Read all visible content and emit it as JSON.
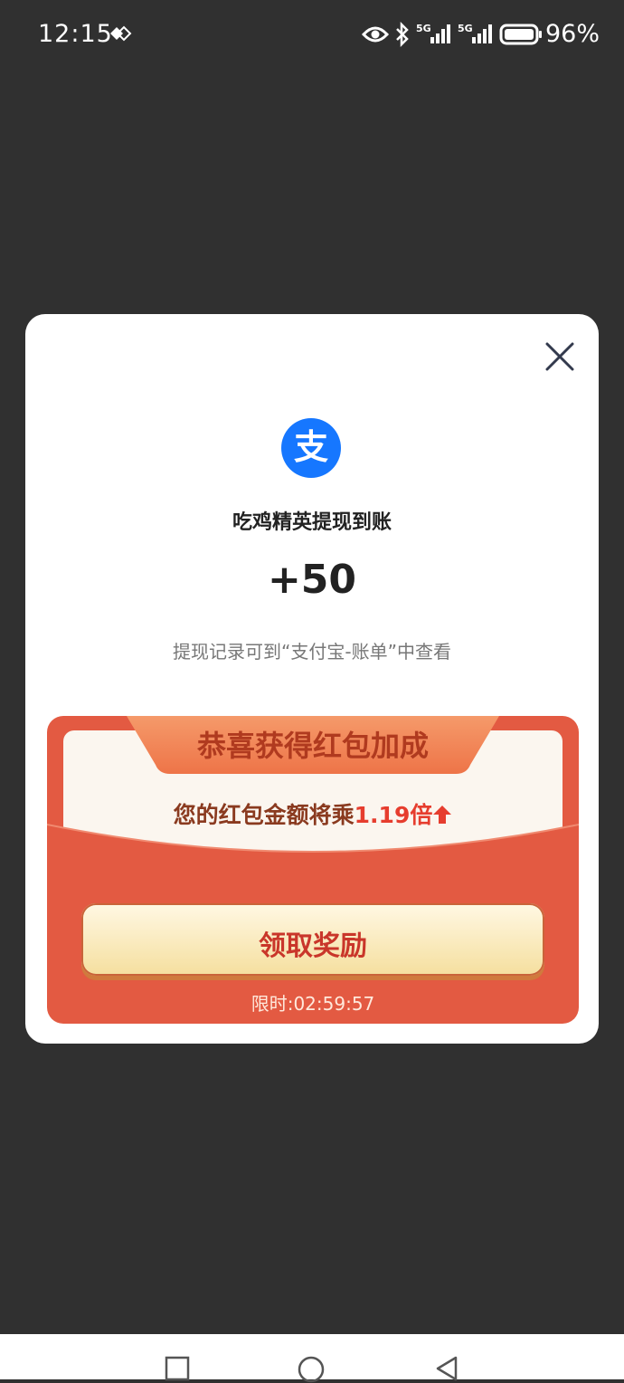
{
  "status_bar": {
    "time": "12:15",
    "battery": "96%",
    "net1": "5G",
    "net2": "5G",
    "icons": [
      "sync-diamond-icon",
      "eye-icon",
      "bluetooth-icon",
      "signal-5g-icon",
      "signal-5g-icon",
      "battery-icon"
    ]
  },
  "dialog": {
    "title": "吃鸡精英提现到账",
    "amount": "+50",
    "hint": "提现记录可到“支付宝-账单”中查看",
    "logo_text": "支",
    "close_icon": "close-icon"
  },
  "red_packet": {
    "banner": "恭喜获得红包加成",
    "bonus_prefix": "您的红包金额将乘",
    "bonus_multiplier": "1.19倍",
    "claim_button": "领取奖励",
    "timer": "限时:02:59:57"
  },
  "nav_bar": {
    "icons": [
      "recent-apps-icon",
      "home-icon",
      "back-icon"
    ]
  },
  "colors": {
    "background": "#303030",
    "alipay_blue": "#1677ff",
    "packet_red": "#e35a42",
    "accent_red": "#e63d2e"
  }
}
